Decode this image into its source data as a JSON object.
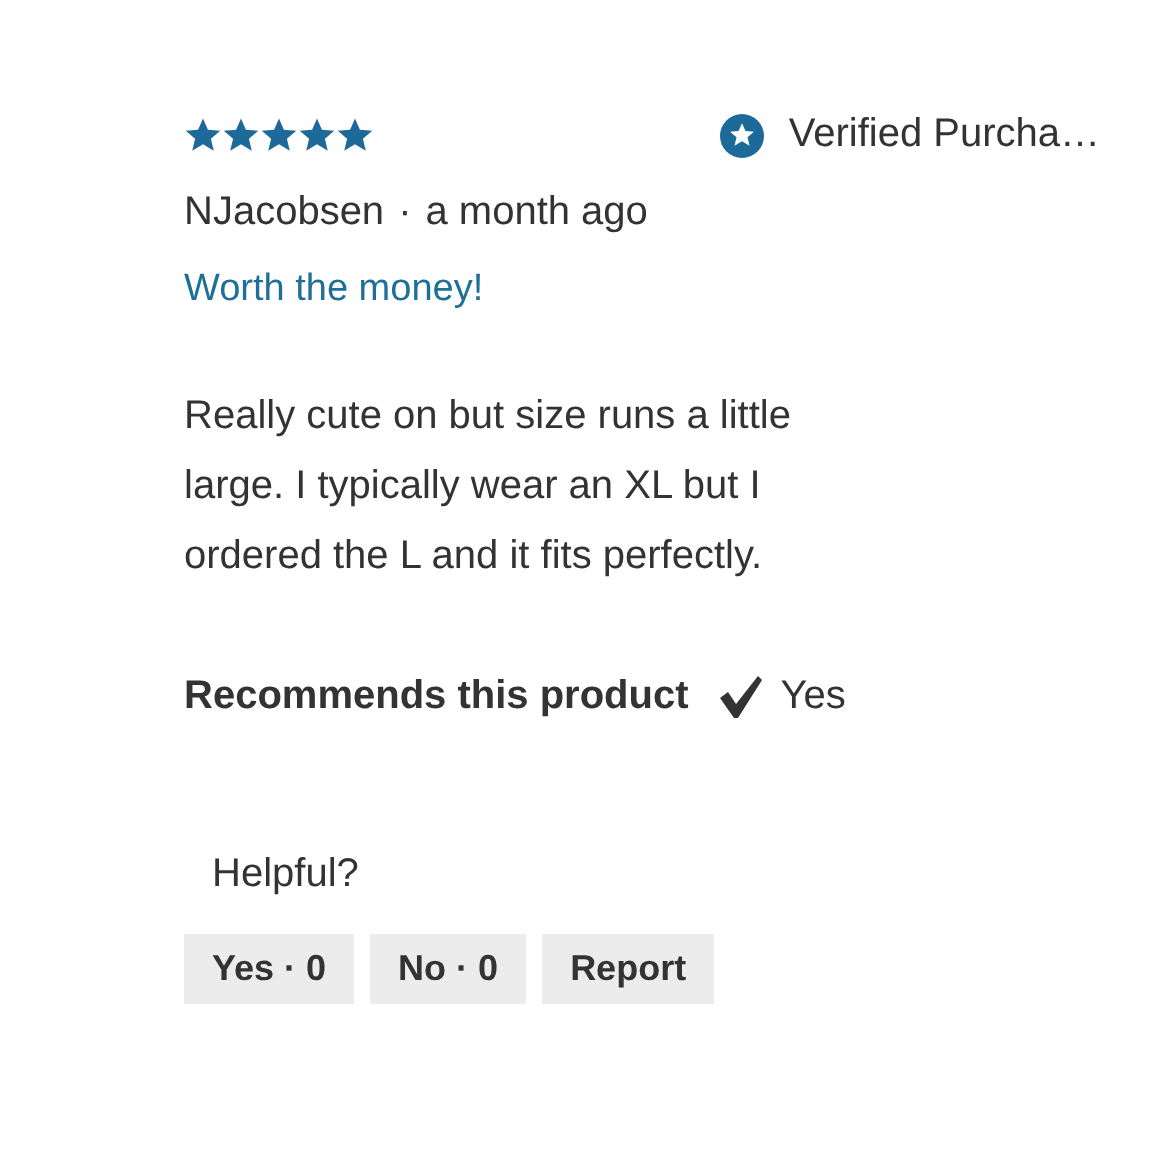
{
  "review": {
    "stars": 5,
    "verified_label": "Verified Purcha…",
    "author": "NJacobsen",
    "separator": "·",
    "date": "a month ago",
    "title": "Worth the money!",
    "body": "Really cute on but size runs a little large. I typically wear an XL but I ordered the L and it fits perfectly.",
    "recommends": {
      "label": "Recommends this product",
      "checked": true,
      "answer": "Yes"
    }
  },
  "helpful": {
    "label": "Helpful?",
    "buttons": [
      "Yes · 0",
      "No · 0",
      "Report"
    ]
  }
}
